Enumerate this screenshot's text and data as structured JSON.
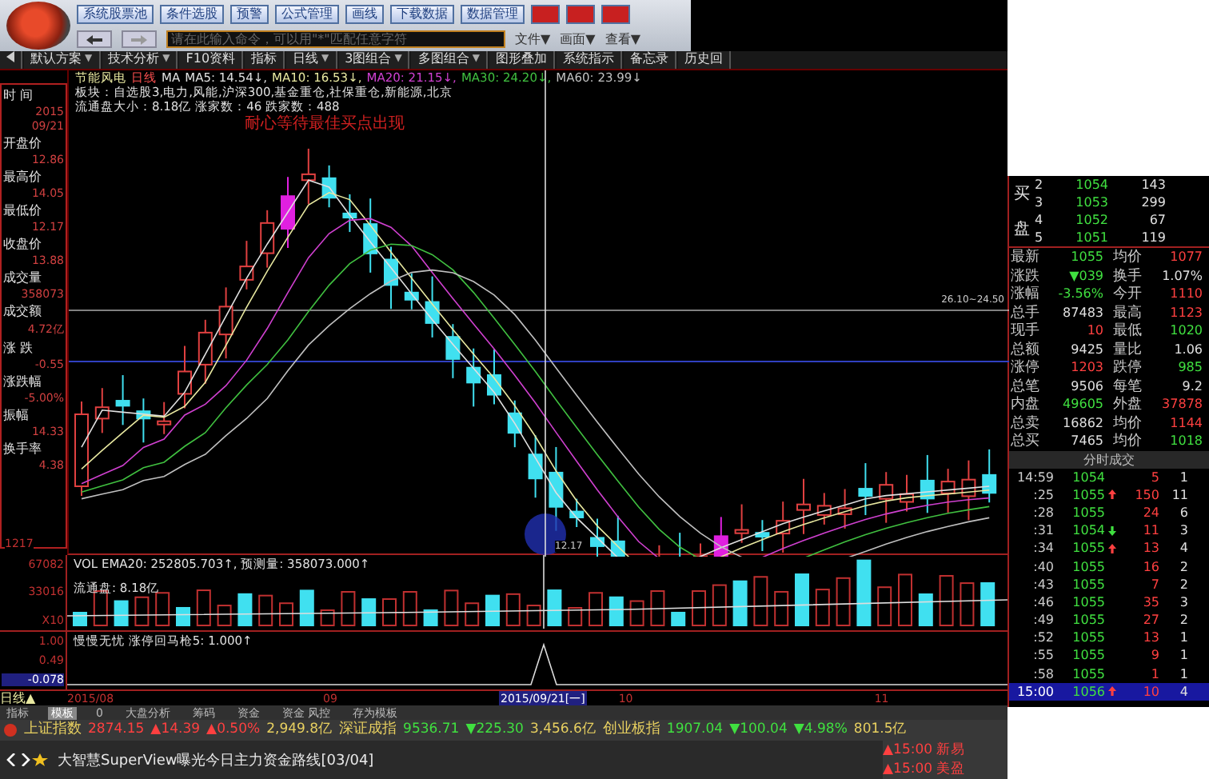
{
  "toolbar": {
    "buttons": [
      {
        "label": "系统股票池",
        "kind": "normal"
      },
      {
        "label": "条件选股",
        "kind": "normal"
      },
      {
        "label": "预警",
        "kind": "normal"
      },
      {
        "label": "公式管理",
        "kind": "normal"
      },
      {
        "label": "画线",
        "kind": "normal"
      },
      {
        "label": "下载数据",
        "kind": "normal"
      },
      {
        "label": "数据管理",
        "kind": "normal"
      },
      {
        "kind": "alert"
      },
      {
        "kind": "alert"
      },
      {
        "kind": "alert"
      }
    ],
    "command_input": {
      "placeholder": "请在此输入命令，可以用\"*\"匹配任意字符"
    },
    "menus": [
      "文件▼",
      "画面▼",
      "查看▼"
    ]
  },
  "tabs": [
    {
      "label": "默认方案",
      "caret": "▼"
    },
    {
      "label": "技术分析",
      "caret": "▼"
    },
    {
      "label": "F10资料"
    },
    {
      "label": "指标"
    },
    {
      "label": "日线",
      "caret": "▼"
    },
    {
      "label": "3图组合",
      "caret": "▼"
    },
    {
      "label": "多图组合",
      "caret": "▼"
    },
    {
      "label": "图形叠加"
    },
    {
      "label": "系统指示"
    },
    {
      "label": "备忘录"
    },
    {
      "label": "历史回"
    }
  ],
  "chart": {
    "stock": "节能风电",
    "period": "日线",
    "ma_prefix": "MA",
    "ma": [
      {
        "label": "MA5: 14.54↓,",
        "color": "#e0e0e0"
      },
      {
        "label": "MA10: 16.53↓,",
        "color": "#e8e8a0"
      },
      {
        "label": "MA20: 21.15↓,",
        "color": "#d040d0"
      },
      {
        "label": "MA30: 24.20↓,",
        "color": "#40c040"
      },
      {
        "label": "MA60: 23.99↓",
        "color": "#c0c0c0"
      }
    ],
    "sector_line": "板块：自选股3,电力,风能,沪深300,基金重仓,社保重仓,新能源,北京",
    "float_line": "流通盘大小：8.18亿   涨家数：46   跌家数：488",
    "signal_text": "耐心等待最佳买点出现",
    "range_label": "26.10~24.50",
    "axis_low": "1217",
    "low_label": "12.17"
  },
  "info_column": [
    {
      "label": "时 间",
      "values": [
        "2015",
        "09/21"
      ]
    },
    {
      "label": "开盘价",
      "values": [
        "12.86"
      ]
    },
    {
      "label": "最高价",
      "values": [
        "14.05"
      ]
    },
    {
      "label": "最低价",
      "values": [
        "12.17"
      ]
    },
    {
      "label": "收盘价",
      "values": [
        "13.88"
      ]
    },
    {
      "label": "成交量",
      "values": [
        "358073"
      ]
    },
    {
      "label": "成交额",
      "values": [
        "4.72亿"
      ]
    },
    {
      "label": "涨 跌",
      "values": [
        "-0.55"
      ]
    },
    {
      "label": "涨跌幅",
      "values": [
        "-5.00%"
      ]
    },
    {
      "label": "振幅",
      "values": [
        "14.33"
      ]
    },
    {
      "label": "换手率",
      "values": [
        "4.38"
      ]
    }
  ],
  "volume": {
    "title": "VOL EMA20: 252805.703↑, 预测量: 358073.000↑",
    "float_label": "流通盘: 8.18亿",
    "axis": [
      "67082",
      "33016",
      "X10"
    ]
  },
  "indicator": {
    "title": "慢慢无忧  涨停回马枪5: 1.000↑",
    "axis": [
      "1.00",
      "0.49",
      "-0.078"
    ]
  },
  "date_axis": {
    "period": "日线▲",
    "labels": [
      "2015/08",
      "09",
      "10",
      "11"
    ],
    "cursor_date": "2015/09/21[一]"
  },
  "bottom_tabs": [
    {
      "label": "指标",
      "selected": false
    },
    {
      "label": "模板",
      "selected": true
    },
    {
      "label": "0",
      "selected": false
    },
    {
      "label": "大盘分析",
      "selected": false
    },
    {
      "label": "筹码",
      "selected": false
    },
    {
      "label": "资金",
      "selected": false
    },
    {
      "label": "资金 风控",
      "selected": false
    },
    {
      "label": "存为模板",
      "selected": false
    }
  ],
  "index_ticker": [
    {
      "name": "上证指数",
      "value": "2874.15",
      "change": "▲14.39",
      "percent": "▲0.50%",
      "amount": "2,949.8亿",
      "color": "#ff4040"
    },
    {
      "name": "深证成指",
      "value": "9536.71",
      "change": "▼225.30",
      "amount": "3,456.6亿",
      "color": "#40e040"
    },
    {
      "name": "创业板指",
      "value": "1907.04",
      "change": "▼100.04",
      "percent": "▼4.98%",
      "amount": "801.5亿",
      "color": "#40e040"
    }
  ],
  "news": "大智慧SuperView曝光今日主力资金路线[03/04]",
  "alerts": [
    "▲15:00 新易",
    "▲15:00 美盈"
  ],
  "order_book": {
    "side_label": [
      "买",
      "盘"
    ],
    "levels": [
      {
        "level": "2",
        "price": "1054",
        "volume": "143"
      },
      {
        "level": "3",
        "price": "1053",
        "volume": "299"
      },
      {
        "level": "4",
        "price": "1052",
        "volume": "67"
      },
      {
        "level": "5",
        "price": "1051",
        "volume": "119"
      }
    ]
  },
  "quote": [
    {
      "cells": [
        {
          "label": "最新",
          "value": "1055",
          "color": "#40e040"
        },
        {
          "label": "均价",
          "value": "1077",
          "color": "#ff4040"
        }
      ]
    },
    {
      "cells": [
        {
          "label": "涨跌",
          "value": "▼039",
          "color": "#40e040"
        },
        {
          "label": "换手",
          "value": "1.07%",
          "color": "#e0e0e0"
        }
      ]
    },
    {
      "cells": [
        {
          "label": "涨幅",
          "value": "-3.56%",
          "color": "#40e040"
        },
        {
          "label": "今开",
          "value": "1110",
          "color": "#ff4040"
        }
      ]
    },
    {
      "cells": [
        {
          "label": "总手",
          "value": "87483",
          "color": "#e0e0e0"
        },
        {
          "label": "最高",
          "value": "1123",
          "color": "#ff4040"
        }
      ]
    },
    {
      "cells": [
        {
          "label": "现手",
          "value": "10",
          "color": "#ff4040"
        },
        {
          "label": "最低",
          "value": "1020",
          "color": "#40e040"
        }
      ]
    },
    {
      "cells": [
        {
          "label": "总额",
          "value": "9425",
          "color": "#e0e0e0"
        },
        {
          "label": "量比",
          "value": "1.06",
          "color": "#e0e0e0"
        }
      ]
    },
    {
      "cells": [
        {
          "label": "涨停",
          "value": "1203",
          "color": "#ff4040"
        },
        {
          "label": "跌停",
          "value": "985",
          "color": "#40e040"
        }
      ]
    },
    {
      "cells": [
        {
          "label": "总笔",
          "value": "9506",
          "color": "#e0e0e0"
        },
        {
          "label": "每笔",
          "value": "9.2",
          "color": "#e0e0e0"
        }
      ]
    },
    {
      "cells": [
        {
          "label": "内盘",
          "value": "49605",
          "color": "#40e040"
        },
        {
          "label": "外盘",
          "value": "37878",
          "color": "#ff4040"
        }
      ]
    },
    {
      "cells": [
        {
          "label": "总卖",
          "value": "16862",
          "color": "#e0e0e0"
        },
        {
          "label": "均价",
          "value": "1144",
          "color": "#ff4040"
        }
      ]
    },
    {
      "cells": [
        {
          "label": "总买",
          "value": "7465",
          "color": "#e0e0e0"
        },
        {
          "label": "均价",
          "value": "1018",
          "color": "#40e040"
        }
      ]
    }
  ],
  "trades_title": "分时成交",
  "trades": [
    {
      "time": "14:59",
      "price": "1054",
      "kind": "plain",
      "volume": "5",
      "count": "1",
      "selected": false
    },
    {
      "time": ":25",
      "price": "1055",
      "kind": "rise",
      "volume": "150",
      "count": "11",
      "selected": false
    },
    {
      "time": ":28",
      "price": "1055",
      "kind": "plain",
      "volume": "24",
      "count": "6",
      "selected": false
    },
    {
      "time": ":31",
      "price": "1054",
      "kind": "fall",
      "volume": "11",
      "count": "3",
      "selected": false
    },
    {
      "time": ":34",
      "price": "1055",
      "kind": "rise",
      "volume": "13",
      "count": "4",
      "selected": false
    },
    {
      "time": ":40",
      "price": "1055",
      "kind": "plain",
      "volume": "16",
      "count": "2",
      "selected": false
    },
    {
      "time": ":43",
      "price": "1055",
      "kind": "plain",
      "volume": "7",
      "count": "2",
      "selected": false
    },
    {
      "time": ":46",
      "price": "1055",
      "kind": "plain",
      "volume": "35",
      "count": "3",
      "selected": false
    },
    {
      "time": ":49",
      "price": "1055",
      "kind": "plain",
      "volume": "27",
      "count": "2",
      "selected": false
    },
    {
      "time": ":52",
      "price": "1055",
      "kind": "plain",
      "volume": "13",
      "count": "1",
      "selected": false
    },
    {
      "time": ":55",
      "price": "1055",
      "kind": "plain",
      "volume": "9",
      "count": "1",
      "selected": false
    },
    {
      "time": ":58",
      "price": "1055",
      "kind": "plain",
      "volume": "1",
      "count": "1",
      "selected": false
    },
    {
      "time": "15:00",
      "price": "1056",
      "kind": "rise",
      "volume": "10",
      "count": "4",
      "selected": true
    }
  ]
}
